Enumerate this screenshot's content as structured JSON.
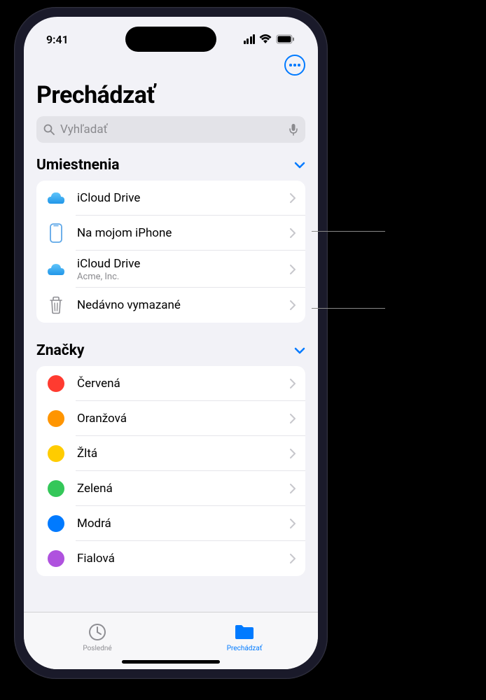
{
  "status": {
    "time": "9:41"
  },
  "page": {
    "title": "Prechádzať"
  },
  "search": {
    "placeholder": "Vyhľadať"
  },
  "sections": {
    "locations": {
      "title": "Umiestnenia",
      "items": [
        {
          "icon": "icloud",
          "label": "iCloud Drive",
          "sublabel": ""
        },
        {
          "icon": "iphone",
          "label": "Na mojom iPhone",
          "sublabel": ""
        },
        {
          "icon": "icloud",
          "label": "iCloud Drive",
          "sublabel": "Acme, Inc."
        },
        {
          "icon": "trash",
          "label": "Nedávno vymazané",
          "sublabel": ""
        }
      ]
    },
    "tags": {
      "title": "Značky",
      "items": [
        {
          "color": "#ff3b30",
          "label": "Červená"
        },
        {
          "color": "#ff9500",
          "label": "Oranžová"
        },
        {
          "color": "#ffcc00",
          "label": "Žltá"
        },
        {
          "color": "#34c759",
          "label": "Zelená"
        },
        {
          "color": "#007aff",
          "label": "Modrá"
        },
        {
          "color": "#af52de",
          "label": "Fialová"
        }
      ]
    }
  },
  "tabs": {
    "recent": "Posledné",
    "browse": "Prechádzať"
  }
}
